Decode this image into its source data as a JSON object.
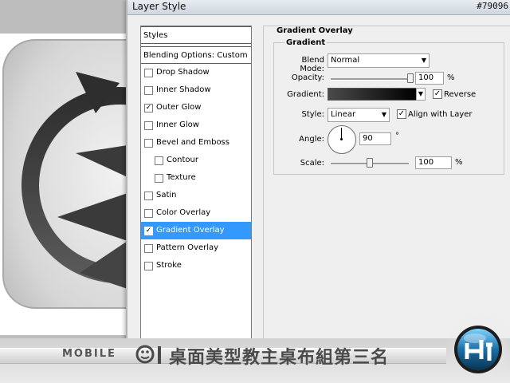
{
  "dialog": {
    "title": "Layer Style",
    "color_code": "#79096"
  },
  "styles_list": {
    "header": "Styles",
    "blending": "Blending Options: Custom",
    "items": [
      {
        "label": "Drop Shadow",
        "checked": false,
        "indent": false
      },
      {
        "label": "Inner Shadow",
        "checked": false,
        "indent": false
      },
      {
        "label": "Outer Glow",
        "checked": true,
        "indent": false
      },
      {
        "label": "Inner Glow",
        "checked": false,
        "indent": false
      },
      {
        "label": "Bevel and Emboss",
        "checked": false,
        "indent": false
      },
      {
        "label": "Contour",
        "checked": false,
        "indent": true
      },
      {
        "label": "Texture",
        "checked": false,
        "indent": true
      },
      {
        "label": "Satin",
        "checked": false,
        "indent": false
      },
      {
        "label": "Color Overlay",
        "checked": false,
        "indent": false
      },
      {
        "label": "Gradient Overlay",
        "checked": true,
        "indent": false,
        "selected": true
      },
      {
        "label": "Pattern Overlay",
        "checked": false,
        "indent": false
      },
      {
        "label": "Stroke",
        "checked": false,
        "indent": false
      }
    ]
  },
  "panel": {
    "title": "Gradient Overlay",
    "group_title": "Gradient",
    "blend_mode_label": "Blend Mode:",
    "blend_mode_value": "Normal",
    "opacity_label": "Opacity:",
    "opacity_value": "100",
    "opacity_unit": "%",
    "opacity_level": 1.0,
    "gradient_label": "Gradient:",
    "reverse_label": "Reverse",
    "reverse_checked": true,
    "style_label": "Style:",
    "style_value": "Linear",
    "align_label": "Align with Layer",
    "align_checked": true,
    "angle_label": "Angle:",
    "angle_value": "90",
    "angle_unit": "°",
    "scale_label": "Scale:",
    "scale_value": "100",
    "scale_unit": "%",
    "scale_level": 0.5,
    "gradient_colors": [
      "#4a4a4a",
      "#000000"
    ]
  },
  "watermark": {
    "brand": "MOBILE",
    "site_name": "桌面美型教主桌布組第三名"
  },
  "colors": {
    "selection": "#3399ff",
    "icon_dark": "#3a3a3a"
  }
}
